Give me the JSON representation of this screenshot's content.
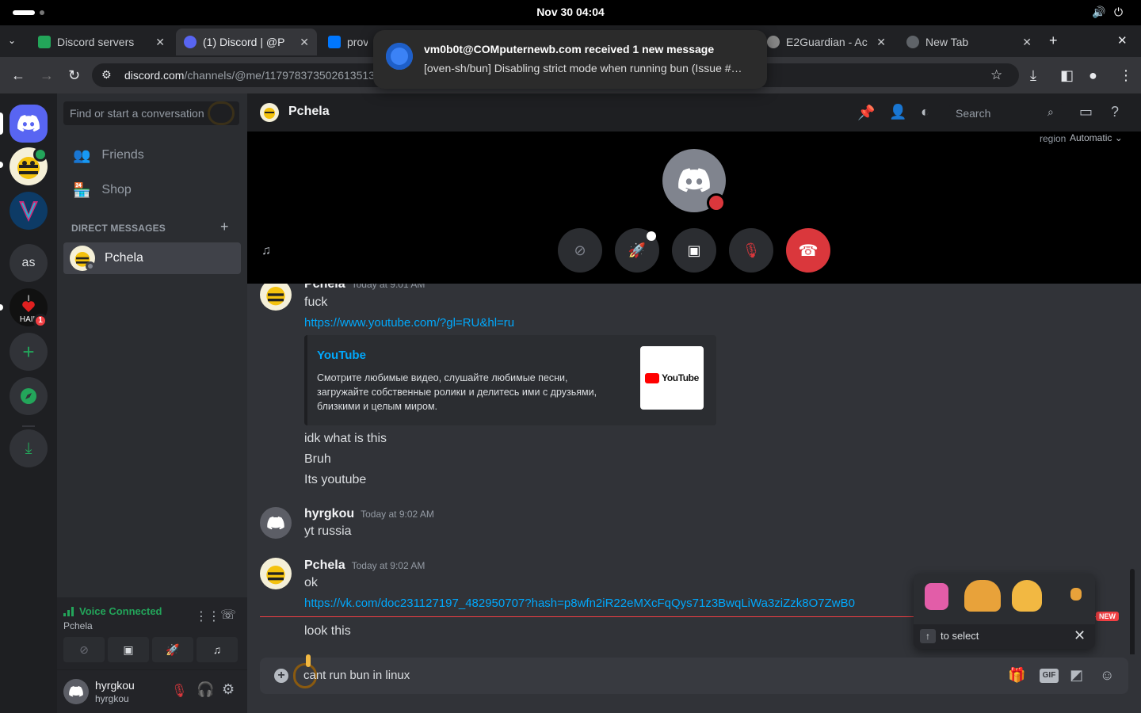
{
  "os": {
    "clock": "Nov 30  04:04"
  },
  "browser": {
    "tabs": [
      {
        "title": "Discord servers",
        "active": false
      },
      {
        "title": "(1) Discord | @P",
        "active": true
      },
      {
        "title": "prov",
        "active": false
      },
      {
        "title": "E2Guardian - Ac",
        "active": false
      },
      {
        "title": "New Tab",
        "active": false
      }
    ],
    "url_host": "discord.com",
    "url_path": "/channels/@me/117978373502613513"
  },
  "notification": {
    "title": "vm0b0t@COMputernewb.com received 1 new message",
    "body": "[oven-sh/bun] Disabling strict mode when running bun (Issue #…"
  },
  "rail": {
    "guilds": [
      {
        "label": "as",
        "color": "#313338"
      }
    ],
    "hail_badge": "1"
  },
  "sidebar": {
    "search_placeholder": "Find or start a conversation",
    "friends": "Friends",
    "shop": "Shop",
    "dm_header": "DIRECT MESSAGES",
    "dm_add": "+",
    "dms": [
      {
        "name": "Pchela"
      }
    ],
    "voice": {
      "status": "Voice Connected",
      "channel": "Pchela"
    },
    "user": {
      "name": "hyrgkou",
      "tag": "hyrgkou"
    }
  },
  "header": {
    "channel": "Pchela",
    "search_placeholder": "Search",
    "region_label": "region",
    "region_value": "Automatic"
  },
  "chat": {
    "messages": [
      {
        "author": "Pchela",
        "time": "Today at 9:01 AM",
        "lines": [
          "fuck"
        ],
        "link": "https://www.youtube.com/?gl=RU&hl=ru"
      },
      {
        "embed_title": "YouTube",
        "embed_desc_1": "Смотрите любимые видео, слушайте любимые песни,",
        "embed_desc_2": "загружайте собственные ролики и делитесь ими с друзьями,",
        "embed_desc_3": "близкими и целым миром.",
        "embed_thumb": "YouTube"
      },
      {
        "lines": [
          "idk what is this",
          "Bruh",
          "Its youtube"
        ]
      },
      {
        "author": "hyrgkou",
        "time": "Today at 9:02 AM",
        "lines": [
          "yt russia"
        ]
      },
      {
        "author": "Pchela",
        "time": "Today at 9:02 AM",
        "lines": [
          "ok"
        ],
        "link": "https://vk.com/doc231127197_482950707?hash=p8wfn2iR22eMXcFqQys71z3BwqLiWa3ziZzk8O7ZwB0"
      },
      {
        "lines": [
          "look this"
        ]
      }
    ],
    "new_badge": "NEW"
  },
  "composer": {
    "value": "cant run bun in linux"
  },
  "sticker_popup": {
    "hint": "to select"
  },
  "colors": {
    "accent": "#5865f2",
    "green": "#23a55a",
    "red": "#da373c",
    "link": "#00a8fc"
  }
}
